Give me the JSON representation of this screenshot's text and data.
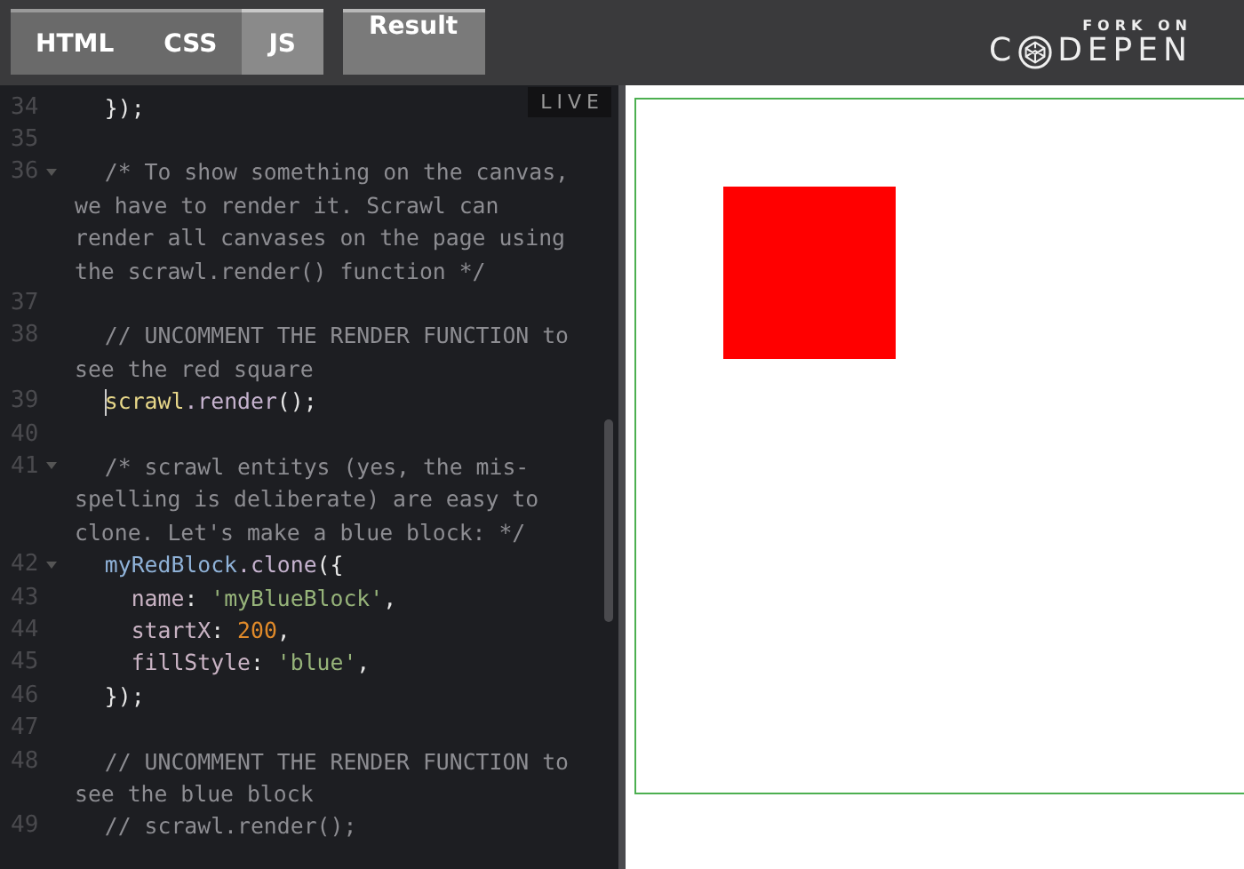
{
  "tabs": [
    {
      "label": "HTML",
      "selected": false
    },
    {
      "label": "CSS",
      "selected": false
    },
    {
      "label": "JS",
      "selected": true
    }
  ],
  "result_button": {
    "label": "Result"
  },
  "fork_logo": {
    "caption": "FORK ON",
    "name_start": "C",
    "name_end": "DEPEN"
  },
  "live_badge": "LIVE",
  "code_lines": [
    {
      "number": "34",
      "fold": false,
      "cursor": false,
      "tokens": [
        {
          "kind": "plain",
          "text": "  });"
        }
      ]
    },
    {
      "number": "35",
      "fold": false,
      "cursor": false
    },
    {
      "number": "36",
      "fold": true,
      "cursor": false,
      "tokens": [
        {
          "kind": "comment",
          "text": "  /* To show something on the canvas,"
        }
      ]
    },
    {
      "tokens": [
        {
          "kind": "comment",
          "text": "we have to render it. Scrawl can"
        }
      ]
    },
    {
      "tokens": [
        {
          "kind": "comment",
          "text": "render all canvases on the page using"
        }
      ]
    },
    {
      "tokens": [
        {
          "kind": "comment",
          "text": "the scrawl.render() function */"
        }
      ]
    },
    {
      "number": "37",
      "fold": false,
      "cursor": false
    },
    {
      "number": "38",
      "fold": false,
      "cursor": false,
      "tokens": [
        {
          "kind": "comment",
          "text": "  // UNCOMMENT THE RENDER FUNCTION to"
        }
      ]
    },
    {
      "tokens": [
        {
          "kind": "comment",
          "text": "see the red square"
        }
      ]
    },
    {
      "number": "39",
      "fold": false,
      "cursor": true,
      "tokens": [
        {
          "kind": "highlight",
          "text": "  scrawl"
        },
        {
          "kind": "method",
          "text": ".render"
        },
        {
          "kind": "plain",
          "text": "();"
        }
      ]
    },
    {
      "number": "40",
      "fold": false,
      "cursor": false
    },
    {
      "number": "41",
      "fold": true,
      "cursor": false,
      "tokens": [
        {
          "kind": "comment",
          "text": "  /* scrawl entitys (yes, the mis-"
        }
      ]
    },
    {
      "tokens": [
        {
          "kind": "comment",
          "text": "spelling is deliberate) are easy to"
        }
      ]
    },
    {
      "tokens": [
        {
          "kind": "comment",
          "text": "clone. Let's make a blue block: */"
        }
      ]
    },
    {
      "number": "42",
      "fold": true,
      "cursor": false,
      "tokens": [
        {
          "kind": "ident",
          "text": "  myRedBlock"
        },
        {
          "kind": "method",
          "text": ".clone"
        },
        {
          "kind": "plain",
          "text": "({"
        }
      ]
    },
    {
      "number": "43",
      "fold": false,
      "cursor": false,
      "tokens": [
        {
          "kind": "prop",
          "text": "    name"
        },
        {
          "kind": "plain",
          "text": ": "
        },
        {
          "kind": "string",
          "text": "'myBlueBlock'"
        },
        {
          "kind": "plain",
          "text": ","
        }
      ]
    },
    {
      "number": "44",
      "fold": false,
      "cursor": false,
      "tokens": [
        {
          "kind": "prop",
          "text": "    startX"
        },
        {
          "kind": "plain",
          "text": ": "
        },
        {
          "kind": "number",
          "text": "200"
        },
        {
          "kind": "plain",
          "text": ","
        }
      ]
    },
    {
      "number": "45",
      "fold": false,
      "cursor": false,
      "tokens": [
        {
          "kind": "prop",
          "text": "    fillStyle"
        },
        {
          "kind": "plain",
          "text": ": "
        },
        {
          "kind": "string",
          "text": "'blue'"
        },
        {
          "kind": "plain",
          "text": ","
        }
      ]
    },
    {
      "number": "46",
      "fold": false,
      "cursor": false,
      "tokens": [
        {
          "kind": "plain",
          "text": "  });"
        }
      ]
    },
    {
      "number": "47",
      "fold": false,
      "cursor": false
    },
    {
      "number": "48",
      "fold": false,
      "cursor": false,
      "tokens": [
        {
          "kind": "comment",
          "text": "  // UNCOMMENT THE RENDER FUNCTION to"
        }
      ]
    },
    {
      "tokens": [
        {
          "kind": "comment",
          "text": "see the blue block"
        }
      ]
    },
    {
      "number": "49",
      "fold": false,
      "cursor": false,
      "tokens": [
        {
          "kind": "comment",
          "text": "  // scrawl.render();"
        }
      ]
    }
  ]
}
